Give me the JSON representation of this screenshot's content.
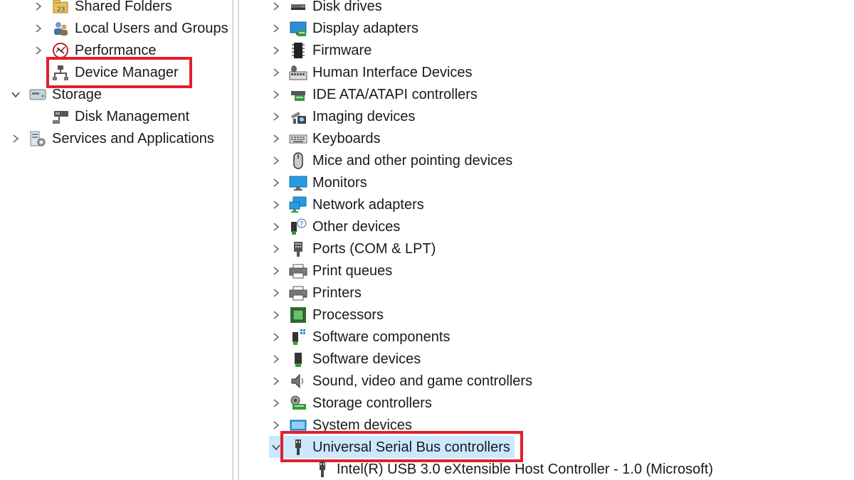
{
  "left_tree": {
    "items": [
      {
        "label": "Shared Folders",
        "icon": "shared-folders-icon",
        "expanded": false
      },
      {
        "label": "Local Users and Groups",
        "icon": "users-icon",
        "expanded": false
      },
      {
        "label": "Performance",
        "icon": "performance-icon",
        "expanded": false
      },
      {
        "label": "Device Manager",
        "icon": "device-manager-icon",
        "selected": true
      },
      {
        "label": "Storage",
        "icon": "storage-icon",
        "expanded": true
      },
      {
        "label": "Disk Management",
        "icon": "disk-management-icon"
      },
      {
        "label": "Services and Applications",
        "icon": "services-icon",
        "expanded": false
      }
    ]
  },
  "device_tree": {
    "categories": [
      {
        "label": "Disk drives",
        "icon": "disk-drive-icon"
      },
      {
        "label": "Display adapters",
        "icon": "display-adapter-icon"
      },
      {
        "label": "Firmware",
        "icon": "firmware-icon"
      },
      {
        "label": "Human Interface Devices",
        "icon": "hid-icon"
      },
      {
        "label": "IDE ATA/ATAPI controllers",
        "icon": "ide-controller-icon"
      },
      {
        "label": "Imaging devices",
        "icon": "imaging-icon"
      },
      {
        "label": "Keyboards",
        "icon": "keyboard-icon"
      },
      {
        "label": "Mice and other pointing devices",
        "icon": "mouse-icon"
      },
      {
        "label": "Monitors",
        "icon": "monitor-icon"
      },
      {
        "label": "Network adapters",
        "icon": "network-adapter-icon"
      },
      {
        "label": "Other devices",
        "icon": "other-devices-icon"
      },
      {
        "label": "Ports (COM & LPT)",
        "icon": "port-icon"
      },
      {
        "label": "Print queues",
        "icon": "print-queue-icon"
      },
      {
        "label": "Printers",
        "icon": "printer-icon"
      },
      {
        "label": "Processors",
        "icon": "processor-icon"
      },
      {
        "label": "Software components",
        "icon": "software-component-icon"
      },
      {
        "label": "Software devices",
        "icon": "software-device-icon"
      },
      {
        "label": "Sound, video and game controllers",
        "icon": "sound-icon"
      },
      {
        "label": "Storage controllers",
        "icon": "storage-controller-icon"
      },
      {
        "label": "System devices",
        "icon": "system-device-icon"
      },
      {
        "label": "Universal Serial Bus controllers",
        "icon": "usb-icon",
        "expanded": true,
        "selected": true
      }
    ],
    "usb_children": [
      {
        "label": "Intel(R) USB 3.0 eXtensible Host Controller - 1.0 (Microsoft)",
        "icon": "usb-device-icon"
      }
    ]
  },
  "colors": {
    "highlight": "#e0202e",
    "selection": "#cce8ff",
    "divider": "#d9d9d9"
  }
}
